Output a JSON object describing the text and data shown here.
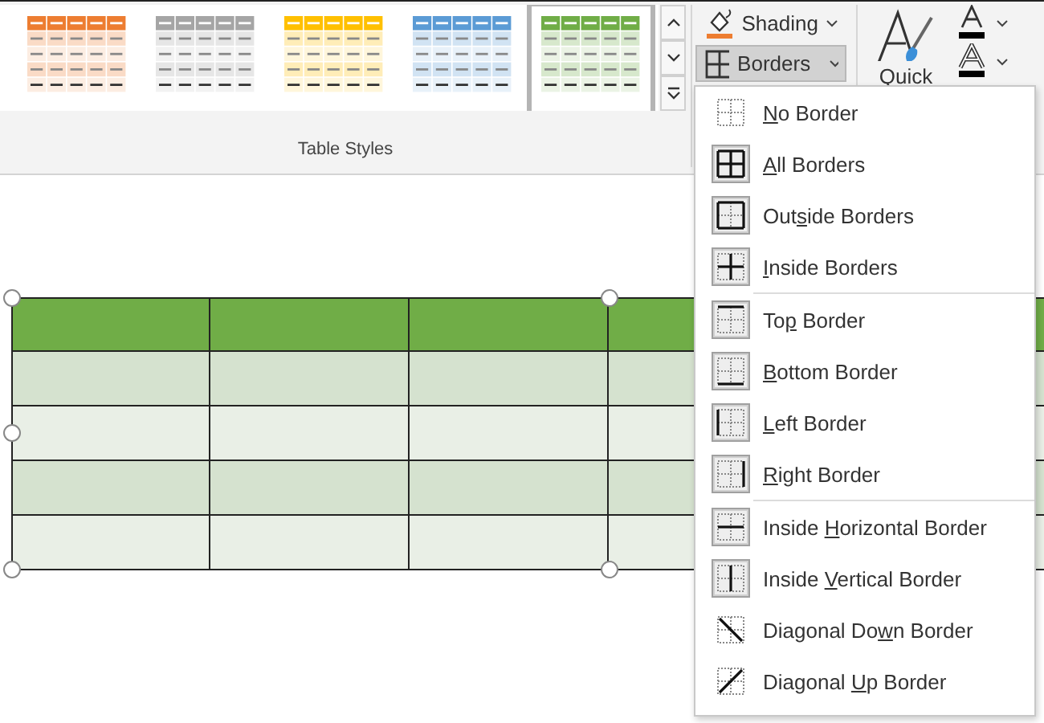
{
  "gallery": {
    "styles": [
      {
        "color": "#ed7d31",
        "selected": false
      },
      {
        "color": "#a5a5a5",
        "selected": false
      },
      {
        "color": "#ffc000",
        "selected": false
      },
      {
        "color": "#5b9bd5",
        "selected": false
      },
      {
        "color": "#70ad47",
        "selected": true
      }
    ],
    "label": "Table Styles"
  },
  "shading": {
    "label": "Shading"
  },
  "borders_button": {
    "label": "Borders",
    "pressed": true
  },
  "quick_styles": {
    "label": "Quick"
  },
  "table": {
    "rows": [
      {
        "kind": "header"
      },
      {
        "kind": "banded"
      },
      {
        "kind": "plain"
      },
      {
        "kind": "banded"
      },
      {
        "kind": "plain"
      }
    ]
  },
  "borders_menu": {
    "groups": [
      [
        {
          "kind": "none",
          "label": {
            "key": "N",
            "post": "o Border"
          },
          "active": false
        },
        {
          "kind": "all",
          "label": {
            "key": "A",
            "post": "ll Borders"
          },
          "active": true
        },
        {
          "kind": "outside",
          "label": {
            "pre": "Out",
            "key": "s",
            "post": "ide Borders"
          },
          "active": true
        },
        {
          "kind": "inside",
          "label": {
            "key": "I",
            "post": "nside Borders"
          },
          "active": true
        }
      ],
      [
        {
          "kind": "top",
          "label": {
            "pre": "To",
            "key": "p",
            "post": " Border"
          },
          "active": true
        },
        {
          "kind": "bottom",
          "label": {
            "key": "B",
            "post": "ottom Border"
          },
          "active": true
        },
        {
          "kind": "left",
          "label": {
            "key": "L",
            "post": "eft Border"
          },
          "active": true
        },
        {
          "kind": "right",
          "label": {
            "key": "R",
            "post": "ight Border"
          },
          "active": true
        }
      ],
      [
        {
          "kind": "inside_h",
          "label": {
            "pre": "Inside ",
            "key": "H",
            "post": "orizontal Border"
          },
          "active": true
        },
        {
          "kind": "inside_v",
          "label": {
            "pre": "Inside ",
            "key": "V",
            "post": "ertical Border"
          },
          "active": true
        },
        {
          "kind": "diag_down",
          "label": {
            "pre": "Diagonal Do",
            "key": "w",
            "post": "n Border"
          },
          "active": false
        },
        {
          "kind": "diag_up",
          "label": {
            "pre": "Diagonal ",
            "key": "U",
            "post": "p Border"
          },
          "active": false
        }
      ]
    ]
  }
}
